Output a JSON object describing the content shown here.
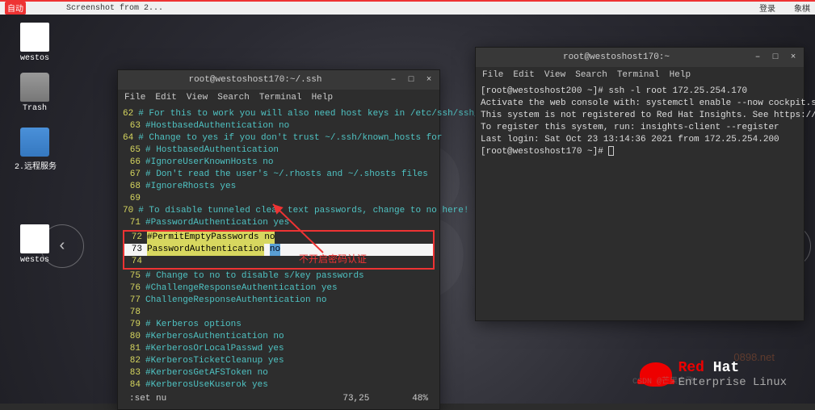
{
  "topbar": {
    "left": "自动",
    "file": "Screenshot from 2...",
    "login": "登录",
    "chess": "象棋"
  },
  "desktop": {
    "icons": [
      {
        "label": "westos",
        "type": "doc"
      },
      {
        "label": "Trash",
        "type": "trash"
      },
      {
        "label": "2.远程服务",
        "type": "folder"
      },
      {
        "label": "westos",
        "type": "doc"
      }
    ]
  },
  "win1": {
    "title": "root@westoshost170:~/.ssh",
    "menus": [
      "File",
      "Edit",
      "View",
      "Search",
      "Terminal",
      "Help"
    ],
    "lines": [
      {
        "n": "62",
        "t": "# For this to work you will also need host keys in /etc/ssh/ssh_known_hosts",
        "c": "cmt"
      },
      {
        "n": "63",
        "t": "#HostbasedAuthentication no",
        "c": "cmt"
      },
      {
        "n": "64",
        "t": "# Change to yes if you don't trust ~/.ssh/known_hosts for",
        "c": "cmt"
      },
      {
        "n": "65",
        "t": "# HostbasedAuthentication",
        "c": "cmt"
      },
      {
        "n": "66",
        "t": "#IgnoreUserKnownHosts no",
        "c": "cmt"
      },
      {
        "n": "67",
        "t": "# Don't read the user's ~/.rhosts and ~/.shosts files",
        "c": "cmt"
      },
      {
        "n": "68",
        "t": "#IgnoreRhosts yes",
        "c": "cmt"
      },
      {
        "n": "69",
        "t": "",
        "c": "plain"
      },
      {
        "n": "70",
        "t": "# To disable tunneled clear text passwords, change to no here!",
        "c": "cmt"
      },
      {
        "n": "71",
        "t": "#PasswordAuthentication yes",
        "c": "cmt"
      }
    ],
    "hl_pre_n": "72",
    "hl_pre_t": "#PermitEmptyPasswords no",
    "hl_n": "73",
    "hl_key": "PasswordAuthentication",
    "hl_val": "no",
    "lines2": [
      {
        "n": "75",
        "t": "# Change to no to disable s/key passwords",
        "c": "cmt"
      },
      {
        "n": "76",
        "t": "#ChallengeResponseAuthentication yes",
        "c": "cmt"
      },
      {
        "n": "77",
        "t": "ChallengeResponseAuthentication no",
        "c": "kw"
      },
      {
        "n": "78",
        "t": "",
        "c": "plain"
      },
      {
        "n": "79",
        "t": "# Kerberos options",
        "c": "cmt"
      },
      {
        "n": "80",
        "t": "#KerberosAuthentication no",
        "c": "cmt"
      },
      {
        "n": "81",
        "t": "#KerberosOrLocalPasswd yes",
        "c": "cmt"
      },
      {
        "n": "82",
        "t": "#KerberosTicketCleanup yes",
        "c": "cmt"
      },
      {
        "n": "83",
        "t": "#KerberosGetAFSToken no",
        "c": "cmt"
      },
      {
        "n": "84",
        "t": "#KerberosUseKuserok yes",
        "c": "cmt"
      }
    ],
    "cmd": ":set nu",
    "pos": "73,25",
    "pct": "48%"
  },
  "win2": {
    "title": "root@westoshost170:~",
    "menus": [
      "File",
      "Edit",
      "View",
      "Search",
      "Terminal",
      "Help"
    ],
    "lines": [
      "[root@westoshost200 ~]# ssh -l root 172.25.254.170",
      "Activate the web console with: systemctl enable --now cockpit.socket",
      "",
      "This system is not registered to Red Hat Insights. See https://cloud.redhat.com/",
      "To register this system, run: insights-client --register",
      "",
      "Last login: Sat Oct 23 13:14:36 2021 from 172.25.254.200",
      "[root@westoshost170 ~]# "
    ]
  },
  "annotation": "不开启密码认证",
  "redhat": {
    "brand": "Red",
    "brand2": "Hat",
    "sub": "Enterprise Linux"
  },
  "watermark1": "0898.net",
  "watermark2": "CSDN @芒果会飞"
}
